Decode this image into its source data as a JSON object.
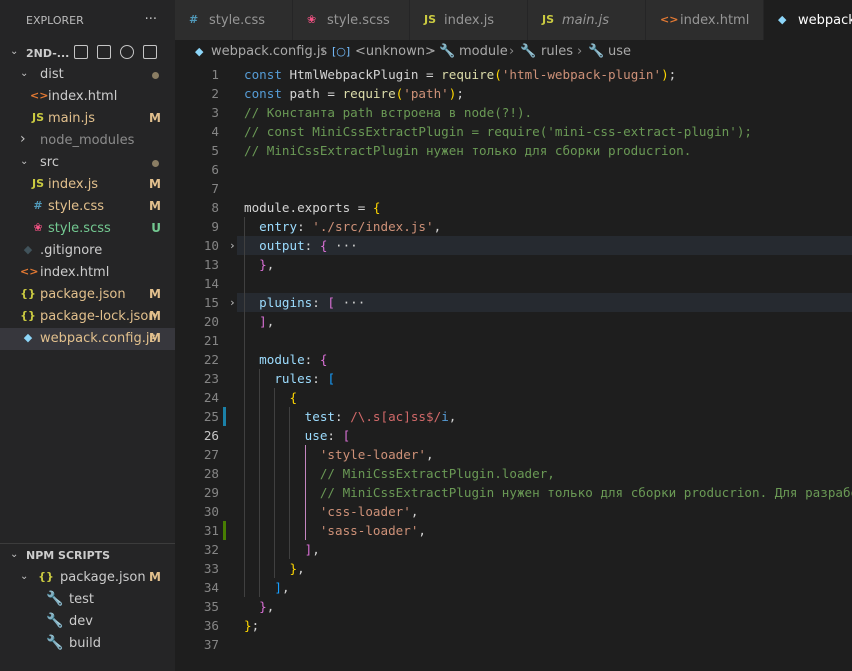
{
  "sidebar": {
    "title": "EXPLORER",
    "more": "···",
    "workspace": "2ND-...",
    "items": [
      {
        "label": "dist",
        "type": "folder",
        "open": true,
        "depth": 0,
        "status": "dot"
      },
      {
        "label": "index.html",
        "type": "html",
        "depth": 1
      },
      {
        "label": "main.js",
        "type": "js",
        "depth": 1,
        "badge": "M"
      },
      {
        "label": "node_modules",
        "type": "folder",
        "open": false,
        "depth": 0
      },
      {
        "label": "src",
        "type": "folder",
        "open": true,
        "depth": 0,
        "status": "dot"
      },
      {
        "label": "index.js",
        "type": "js",
        "depth": 1,
        "badge": "M"
      },
      {
        "label": "style.css",
        "type": "css",
        "depth": 1,
        "badge": "M"
      },
      {
        "label": "style.scss",
        "type": "scss",
        "depth": 1,
        "badge": "U"
      },
      {
        "label": ".gitignore",
        "type": "git",
        "depth": 0
      },
      {
        "label": "index.html",
        "type": "html",
        "depth": 0
      },
      {
        "label": "package.json",
        "type": "json",
        "depth": 0,
        "badge": "M"
      },
      {
        "label": "package-lock.json",
        "type": "json",
        "depth": 0,
        "badge": "M"
      },
      {
        "label": "webpack.config.js",
        "type": "webpack",
        "depth": 0,
        "badge": "M",
        "selected": true
      }
    ],
    "npm": {
      "title": "NPM SCRIPTS",
      "file": "package.json",
      "badge": "M",
      "scripts": [
        "test",
        "dev",
        "build"
      ]
    }
  },
  "tabs": [
    {
      "label": "style.css",
      "type": "css"
    },
    {
      "label": "style.scss",
      "type": "scss"
    },
    {
      "label": "index.js",
      "type": "js"
    },
    {
      "label": "main.js",
      "type": "js",
      "italic": true
    },
    {
      "label": "index.html",
      "type": "html"
    },
    {
      "label": "webpack",
      "type": "webpack",
      "active": true
    }
  ],
  "breadcrumb": [
    "webpack.config.js",
    "<unknown>",
    "module",
    "rules",
    "use"
  ],
  "editor": {
    "line_numbers": [
      "1",
      "2",
      "3",
      "4",
      "5",
      "6",
      "7",
      "8",
      "9",
      "10",
      "13",
      "14",
      "15",
      "20",
      "21",
      "22",
      "23",
      "24",
      "25",
      "26",
      "27",
      "28",
      "29",
      "30",
      "31",
      "32",
      "33",
      "34",
      "35",
      "36",
      "37"
    ],
    "lines": [
      [
        [
          "k",
          "const "
        ],
        [
          "w",
          "HtmlWebpackPlugin = "
        ],
        [
          "f",
          "require"
        ],
        [
          "by",
          "("
        ],
        [
          "s",
          "'html-webpack-plugin'"
        ],
        [
          "by",
          ")"
        ],
        [
          "w",
          ";"
        ]
      ],
      [
        [
          "k",
          "const "
        ],
        [
          "w",
          "path = "
        ],
        [
          "f",
          "require"
        ],
        [
          "by",
          "("
        ],
        [
          "s",
          "'path'"
        ],
        [
          "by",
          ")"
        ],
        [
          "w",
          ";"
        ]
      ],
      [
        [
          "c",
          "// Константа path встроена в node(?!)."
        ]
      ],
      [
        [
          "c",
          "// const MiniCssExtractPlugin = require('mini-css-extract-plugin');"
        ]
      ],
      [
        [
          "c",
          "// MiniCssExtractPlugin нужен только для сборки producrion."
        ]
      ],
      [],
      [],
      [
        [
          "w",
          "module.exports = "
        ],
        [
          "by",
          "{"
        ]
      ],
      [
        [
          "w",
          "  "
        ],
        [
          "v",
          "entry"
        ],
        [
          "w",
          ": "
        ],
        [
          "s",
          "'./src/index.js'"
        ],
        [
          "w",
          ","
        ]
      ],
      [
        [
          "w",
          "  "
        ],
        [
          "v",
          "output"
        ],
        [
          "w",
          ": "
        ],
        [
          "bp",
          "{"
        ],
        [
          "w",
          " ···"
        ]
      ],
      [
        [
          "w",
          "  "
        ],
        [
          "bp",
          "}"
        ],
        [
          "w",
          ","
        ]
      ],
      [],
      [
        [
          "w",
          "  "
        ],
        [
          "v",
          "plugins"
        ],
        [
          "w",
          ": "
        ],
        [
          "bp",
          "["
        ],
        [
          "w",
          " ···"
        ]
      ],
      [
        [
          "w",
          "  "
        ],
        [
          "bp",
          "]"
        ],
        [
          "w",
          ","
        ]
      ],
      [],
      [
        [
          "w",
          "  "
        ],
        [
          "v",
          "module"
        ],
        [
          "w",
          ": "
        ],
        [
          "bp",
          "{"
        ]
      ],
      [
        [
          "w",
          "    "
        ],
        [
          "v",
          "rules"
        ],
        [
          "w",
          ": "
        ],
        [
          "bb",
          "["
        ]
      ],
      [
        [
          "w",
          "      "
        ],
        [
          "by",
          "{"
        ]
      ],
      [
        [
          "w",
          "        "
        ],
        [
          "v",
          "test"
        ],
        [
          "w",
          ": "
        ],
        [
          "r",
          "/\\.s[ac]ss$/"
        ],
        [
          "k",
          "i"
        ],
        [
          "w",
          ","
        ]
      ],
      [
        [
          "w",
          "        "
        ],
        [
          "v",
          "use"
        ],
        [
          "w",
          ": "
        ],
        [
          "bp",
          "["
        ]
      ],
      [
        [
          "w",
          "          "
        ],
        [
          "s",
          "'style-loader'"
        ],
        [
          "w",
          ","
        ]
      ],
      [
        [
          "w",
          "          "
        ],
        [
          "c",
          "// MiniCssExtractPlugin.loader,"
        ]
      ],
      [
        [
          "w",
          "          "
        ],
        [
          "c",
          "// MiniCssExtractPlugin нужен только для сборки producrion. Для разработки"
        ]
      ],
      [
        [
          "w",
          "          "
        ],
        [
          "s",
          "'css-loader'"
        ],
        [
          "w",
          ","
        ]
      ],
      [
        [
          "w",
          "          "
        ],
        [
          "s",
          "'sass-loader'"
        ],
        [
          "w",
          ","
        ]
      ],
      [
        [
          "w",
          "        "
        ],
        [
          "bp",
          "]"
        ],
        [
          "w",
          ","
        ]
      ],
      [
        [
          "w",
          "      "
        ],
        [
          "by",
          "}"
        ],
        [
          "w",
          ","
        ]
      ],
      [
        [
          "w",
          "    "
        ],
        [
          "bb",
          "]"
        ],
        [
          "w",
          ","
        ]
      ],
      [
        [
          "w",
          "  "
        ],
        [
          "bp",
          "}"
        ],
        [
          "w",
          ","
        ]
      ],
      [
        [
          "by",
          "}"
        ],
        [
          "w",
          ";"
        ]
      ],
      []
    ]
  },
  "colors": {
    "js": "#cbcb41",
    "css": "#519aba",
    "scss": "#f55385",
    "html": "#e37933",
    "json": "#cbcb41",
    "git": "#41535b",
    "webpack": "#8dd6f9",
    "badge_M": "#e2c08d",
    "badge_U": "#73c991"
  }
}
